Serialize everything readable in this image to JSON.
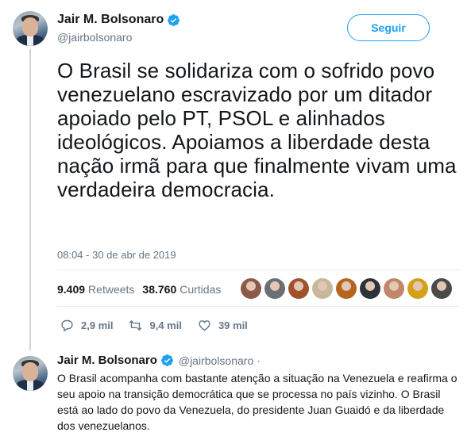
{
  "tweet": {
    "display_name": "Jair M. Bolsonaro",
    "handle": "@jairbolsonaro",
    "follow_label": "Seguir",
    "text": "O Brasil se solidariza com o sofrido povo venezuelano escravizado por um ditador apoiado pelo PT, PSOL e alinhados ideológicos. Apoiamos a liberdade desta nação irmã para que finalmente vivam uma verdadeira democracia.",
    "timestamp": "08:04 - 30 de abr de 2019",
    "retweets_count": "9.409",
    "retweets_label": "Retweets",
    "likes_count": "38.760",
    "likes_label": "Curtidas",
    "reply_count": "2,9 mil",
    "retweet_action_count": "9,4 mil",
    "like_action_count": "39 mil"
  },
  "likers": [
    "#8c5a4a",
    "#6b6f73",
    "#a0522d",
    "#c9b79c",
    "#b5651d",
    "#2f3338",
    "#c2876a",
    "#d4a017",
    "#4a4a4a"
  ],
  "reply": {
    "display_name": "Jair M. Bolsonaro",
    "handle": "@jairbolsonaro",
    "separator": "·",
    "text": "O Brasil acompanha com bastante atenção a situação na Venezuela e reafirma o seu apoio na transição democrática que se processa no país vizinho. O Brasil está ao lado do povo da Venezuela, do presidente Juan Guaidó e da liberdade dos venezuelanos."
  },
  "colors": {
    "accent": "#1da1f2",
    "muted": "#657786",
    "text": "#14171a",
    "line": "#ccd6dd"
  }
}
